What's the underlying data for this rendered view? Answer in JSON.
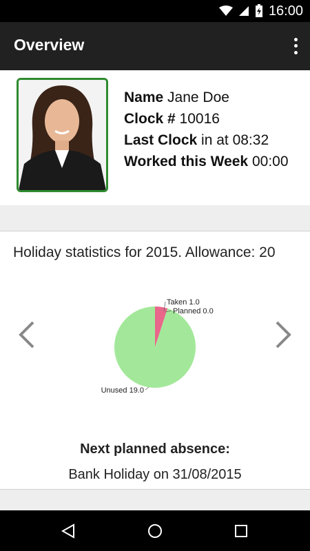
{
  "status_bar": {
    "time": "16:00",
    "icons": [
      "wifi-icon",
      "signal-icon",
      "battery-charging-icon"
    ]
  },
  "app_bar": {
    "title": "Overview",
    "menu_icon": "overflow-menu-icon"
  },
  "profile": {
    "name_label": "Name",
    "name_value": "Jane Doe",
    "clock_label": "Clock #",
    "clock_value": "10016",
    "last_clock_label": "Last Clock",
    "last_clock_value": "in at 08:32",
    "worked_label": "Worked this Week",
    "worked_value": "00:00"
  },
  "holiday": {
    "title": "Holiday statistics for 2015. Allowance: 20",
    "next_label": "Next planned absence:",
    "next_value": "Bank Holiday on 31/08/2015"
  },
  "chart_data": {
    "type": "pie",
    "labels": [
      "Taken",
      "Planned",
      "Unused"
    ],
    "values": [
      1.0,
      0.0,
      19.0
    ],
    "label_texts": [
      "Taken 1.0",
      "Planned 0.0",
      "Unused 19.0"
    ],
    "colors": [
      "#e8678a",
      "#f4b400",
      "#a3e89a"
    ]
  },
  "nav_bar": {
    "icons": [
      "back-icon",
      "home-icon",
      "recents-icon"
    ]
  }
}
